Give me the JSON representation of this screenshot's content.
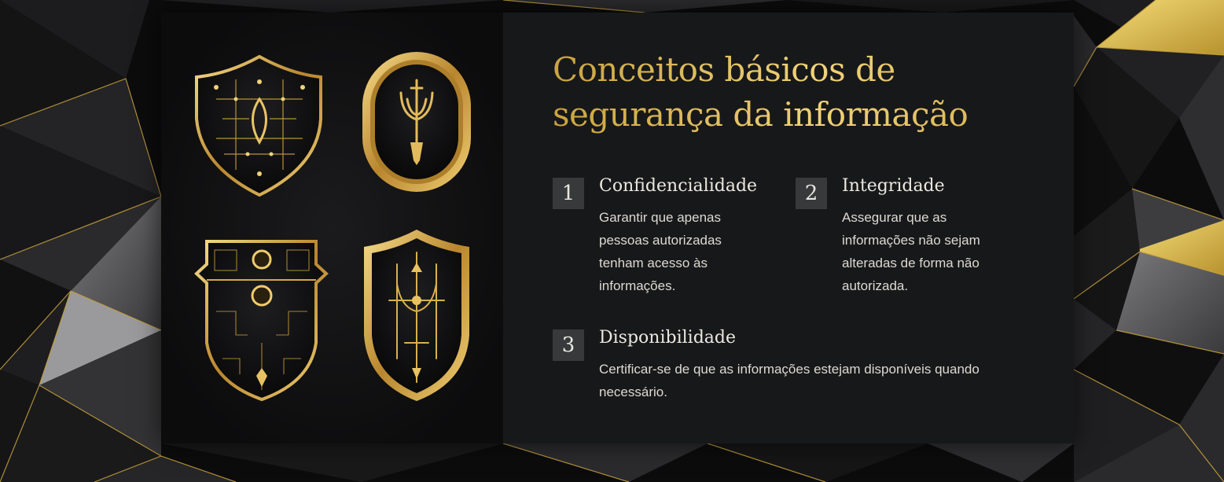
{
  "slide": {
    "title": "Conceitos básicos de segurança da informação",
    "items": [
      {
        "number": "1",
        "title": "Confidencialidade",
        "description": "Garantir que apenas pessoas autorizadas tenham acesso às informações."
      },
      {
        "number": "2",
        "title": "Integridade",
        "description": "Assegurar que as informações não sejam alteradas de forma não autorizada."
      },
      {
        "number": "3",
        "title": "Disponibilidade",
        "description": "Certificar-se de que as informações estejam disponíveis quando necessário."
      }
    ],
    "illustration": {
      "icons": [
        "shield-circuit-icon",
        "oval-trident-emblem-icon",
        "circuit-crest-icon",
        "shield-trident-icon"
      ]
    }
  },
  "colors": {
    "gold": "#d9b24f",
    "card_background": "#17181a",
    "number_badge": "#37393b",
    "text": "#dedad2"
  }
}
